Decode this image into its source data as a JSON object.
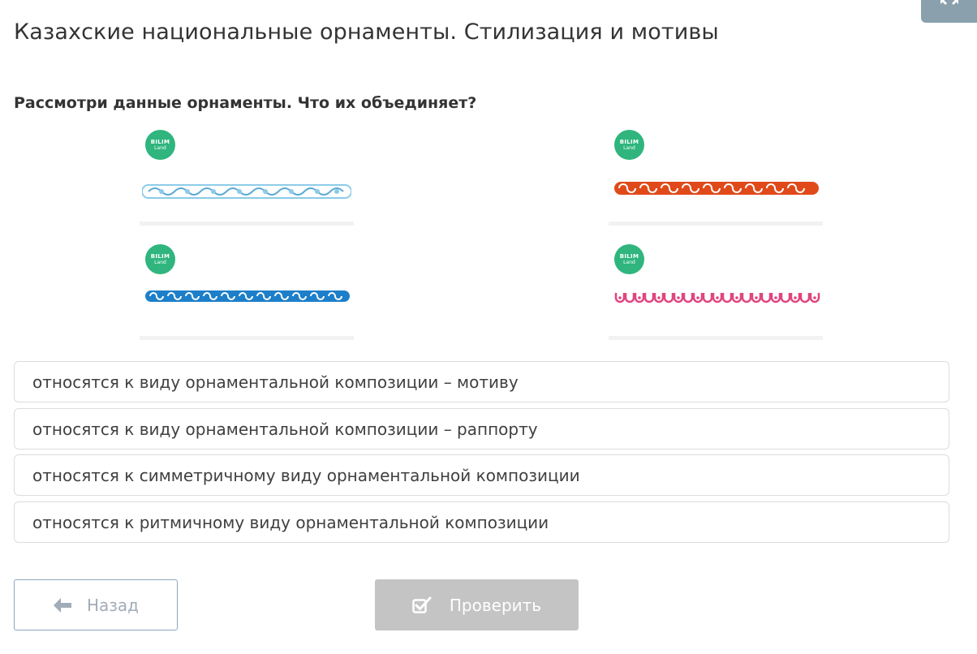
{
  "header": {
    "title": "Казахские национальные орнаменты. Стилизация и мотивы",
    "fullscreen_icon": "fullscreen-icon"
  },
  "question": {
    "text": "Рассмотри данные орнаменты. Что их объединяет?"
  },
  "ornaments": [
    {
      "badge_top": "BILIM",
      "badge_bottom": "Land",
      "color": "#8ccbe8",
      "accent": "#5aa9d6"
    },
    {
      "badge_top": "BILIM",
      "badge_bottom": "Land",
      "color": "#e04a1a",
      "accent": "#c73a10"
    },
    {
      "badge_top": "BILIM",
      "badge_bottom": "Land",
      "color": "#1d7fc9",
      "accent": "#1568a8"
    },
    {
      "badge_top": "BILIM",
      "badge_bottom": "Land",
      "color": "#e0457f",
      "accent": "#c8306a"
    }
  ],
  "options": [
    {
      "label": "относятся к виду орнаментальной композиции – мотиву"
    },
    {
      "label": "относятся к виду орнаментальной композиции – раппорту"
    },
    {
      "label": "относятся к симметричному виду орнаментальной композиции"
    },
    {
      "label": "относятся к ритмичному виду орнаментальной композиции"
    }
  ],
  "footer": {
    "back_label": "Назад",
    "back_icon": "arrow-left-icon",
    "check_label": "Проверить",
    "check_icon": "checkbox-icon"
  },
  "colors": {
    "badge": "#2fb57d",
    "check_button": "#c4c4c4",
    "back_border": "#8ea7bf"
  }
}
